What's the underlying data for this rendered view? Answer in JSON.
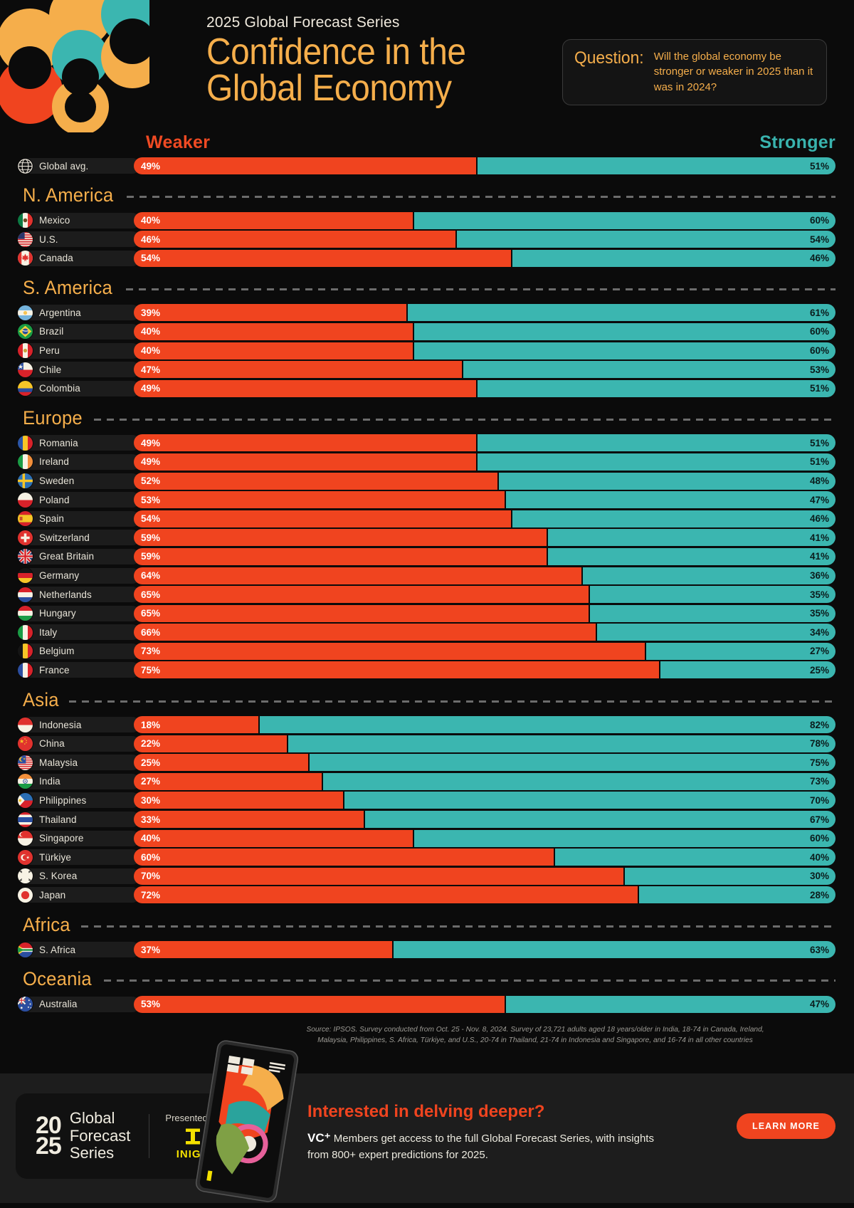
{
  "header": {
    "kicker": "2025 Global Forecast Series",
    "title_line1": "Confidence in the",
    "title_line2": "Global Economy",
    "question_label": "Question:",
    "question_text": "Will the global economy be stronger or weaker in 2025 than it was in 2024?"
  },
  "legend": {
    "weaker": "Weaker",
    "stronger": "Stronger",
    "weaker_color": "#f0441f",
    "stronger_color": "#3bb6b0",
    "accent_color": "#f5ae4b"
  },
  "source_line1": "Source: IPSOS. Survey conducted from Oct. 25 - Nov. 8, 2024. Survey of 23,721 adults aged 18 years/older in India, 18-74 in Canada, Ireland,",
  "source_line2": "Malaysia, Philippines, S. Africa, Türkiye, and U.S., 20-74 in Thailand, 21-74 in Indonesia and Singapore, and 16-74 in all other countries",
  "footer": {
    "logo_num_top": "20",
    "logo_num_bottom": "25",
    "logo_word1": "Global",
    "logo_word2": "Forecast",
    "logo_word3": "Series",
    "presented_by": "Presented By",
    "sponsor": "INIGO",
    "cta_title": "Interested in delving deeper?",
    "cta_vc": "VC⁺",
    "cta_body": " Members get access to the full Global Forecast Series, with insights from 800+ expert predictions for 2025.",
    "learn_more": "LEARN MORE"
  },
  "chart_data": {
    "type": "bar",
    "subtype": "diverging-stacked-100",
    "title": "Confidence in the Global Economy",
    "subtitle": "2025 Global Forecast Series",
    "series": [
      {
        "name": "Weaker",
        "color": "#f0441f"
      },
      {
        "name": "Stronger",
        "color": "#3bb6b0"
      }
    ],
    "xlabel": "",
    "ylabel": "",
    "xlim": [
      0,
      100
    ],
    "grid": false,
    "legend_position": "top",
    "global": {
      "label": "Global avg.",
      "flag": "globe-icon",
      "weaker": 49,
      "stronger": 51,
      "weaker_label": "49%",
      "stronger_label": "51%"
    },
    "groups": [
      {
        "name": "N. America",
        "rows": [
          {
            "label": "Mexico",
            "flag": "mx",
            "weaker": 40,
            "stronger": 60,
            "weaker_label": "40%",
            "stronger_label": "60%"
          },
          {
            "label": "U.S.",
            "flag": "us",
            "weaker": 46,
            "stronger": 54,
            "weaker_label": "46%",
            "stronger_label": "54%"
          },
          {
            "label": "Canada",
            "flag": "ca",
            "weaker": 54,
            "stronger": 46,
            "weaker_label": "54%",
            "stronger_label": "46%"
          }
        ]
      },
      {
        "name": "S. America",
        "rows": [
          {
            "label": "Argentina",
            "flag": "ar",
            "weaker": 39,
            "stronger": 61,
            "weaker_label": "39%",
            "stronger_label": "61%"
          },
          {
            "label": "Brazil",
            "flag": "br",
            "weaker": 40,
            "stronger": 60,
            "weaker_label": "40%",
            "stronger_label": "60%"
          },
          {
            "label": "Peru",
            "flag": "pe",
            "weaker": 40,
            "stronger": 60,
            "weaker_label": "40%",
            "stronger_label": "60%"
          },
          {
            "label": "Chile",
            "flag": "cl",
            "weaker": 47,
            "stronger": 53,
            "weaker_label": "47%",
            "stronger_label": "53%"
          },
          {
            "label": "Colombia",
            "flag": "co",
            "weaker": 49,
            "stronger": 51,
            "weaker_label": "49%",
            "stronger_label": "51%"
          }
        ]
      },
      {
        "name": "Europe",
        "rows": [
          {
            "label": "Romania",
            "flag": "ro",
            "weaker": 49,
            "stronger": 51,
            "weaker_label": "49%",
            "stronger_label": "51%"
          },
          {
            "label": "Ireland",
            "flag": "ie",
            "weaker": 49,
            "stronger": 51,
            "weaker_label": "49%",
            "stronger_label": "51%"
          },
          {
            "label": "Sweden",
            "flag": "se",
            "weaker": 52,
            "stronger": 48,
            "weaker_label": "52%",
            "stronger_label": "48%"
          },
          {
            "label": "Poland",
            "flag": "pl",
            "weaker": 53,
            "stronger": 47,
            "weaker_label": "53%",
            "stronger_label": "47%"
          },
          {
            "label": "Spain",
            "flag": "es",
            "weaker": 54,
            "stronger": 46,
            "weaker_label": "54%",
            "stronger_label": "46%"
          },
          {
            "label": "Switzerland",
            "flag": "ch",
            "weaker": 59,
            "stronger": 41,
            "weaker_label": "59%",
            "stronger_label": "41%"
          },
          {
            "label": "Great Britain",
            "flag": "gb",
            "weaker": 59,
            "stronger": 41,
            "weaker_label": "59%",
            "stronger_label": "41%"
          },
          {
            "label": "Germany",
            "flag": "de",
            "weaker": 64,
            "stronger": 36,
            "weaker_label": "64%",
            "stronger_label": "36%"
          },
          {
            "label": "Netherlands",
            "flag": "nl",
            "weaker": 65,
            "stronger": 35,
            "weaker_label": "65%",
            "stronger_label": "35%"
          },
          {
            "label": "Hungary",
            "flag": "hu",
            "weaker": 65,
            "stronger": 35,
            "weaker_label": "65%",
            "stronger_label": "35%"
          },
          {
            "label": "Italy",
            "flag": "it",
            "weaker": 66,
            "stronger": 34,
            "weaker_label": "66%",
            "stronger_label": "34%"
          },
          {
            "label": "Belgium",
            "flag": "be",
            "weaker": 73,
            "stronger": 27,
            "weaker_label": "73%",
            "stronger_label": "27%"
          },
          {
            "label": "France",
            "flag": "fr",
            "weaker": 75,
            "stronger": 25,
            "weaker_label": "75%",
            "stronger_label": "25%"
          }
        ]
      },
      {
        "name": "Asia",
        "rows": [
          {
            "label": "Indonesia",
            "flag": "id",
            "weaker": 18,
            "stronger": 82,
            "weaker_label": "18%",
            "stronger_label": "82%"
          },
          {
            "label": "China",
            "flag": "cn",
            "weaker": 22,
            "stronger": 78,
            "weaker_label": "22%",
            "stronger_label": "78%"
          },
          {
            "label": "Malaysia",
            "flag": "my",
            "weaker": 25,
            "stronger": 75,
            "weaker_label": "25%",
            "stronger_label": "75%"
          },
          {
            "label": "India",
            "flag": "in",
            "weaker": 27,
            "stronger": 73,
            "weaker_label": "27%",
            "stronger_label": "73%"
          },
          {
            "label": "Philippines",
            "flag": "ph",
            "weaker": 30,
            "stronger": 70,
            "weaker_label": "30%",
            "stronger_label": "70%"
          },
          {
            "label": "Thailand",
            "flag": "th",
            "weaker": 33,
            "stronger": 67,
            "weaker_label": "33%",
            "stronger_label": "67%"
          },
          {
            "label": "Singapore",
            "flag": "sg",
            "weaker": 40,
            "stronger": 60,
            "weaker_label": "40%",
            "stronger_label": "60%"
          },
          {
            "label": "Türkiye",
            "flag": "tr",
            "weaker": 60,
            "stronger": 40,
            "weaker_label": "60%",
            "stronger_label": "40%"
          },
          {
            "label": "S. Korea",
            "flag": "kr",
            "weaker": 70,
            "stronger": 30,
            "weaker_label": "70%",
            "stronger_label": "30%"
          },
          {
            "label": "Japan",
            "flag": "jp",
            "weaker": 72,
            "stronger": 28,
            "weaker_label": "72%",
            "stronger_label": "28%"
          }
        ]
      },
      {
        "name": "Africa",
        "rows": [
          {
            "label": "S. Africa",
            "flag": "za",
            "weaker": 37,
            "stronger": 63,
            "weaker_label": "37%",
            "stronger_label": "63%"
          }
        ]
      },
      {
        "name": "Oceania",
        "rows": [
          {
            "label": "Australia",
            "flag": "au",
            "weaker": 53,
            "stronger": 47,
            "weaker_label": "53%",
            "stronger_label": "47%"
          }
        ]
      }
    ]
  }
}
